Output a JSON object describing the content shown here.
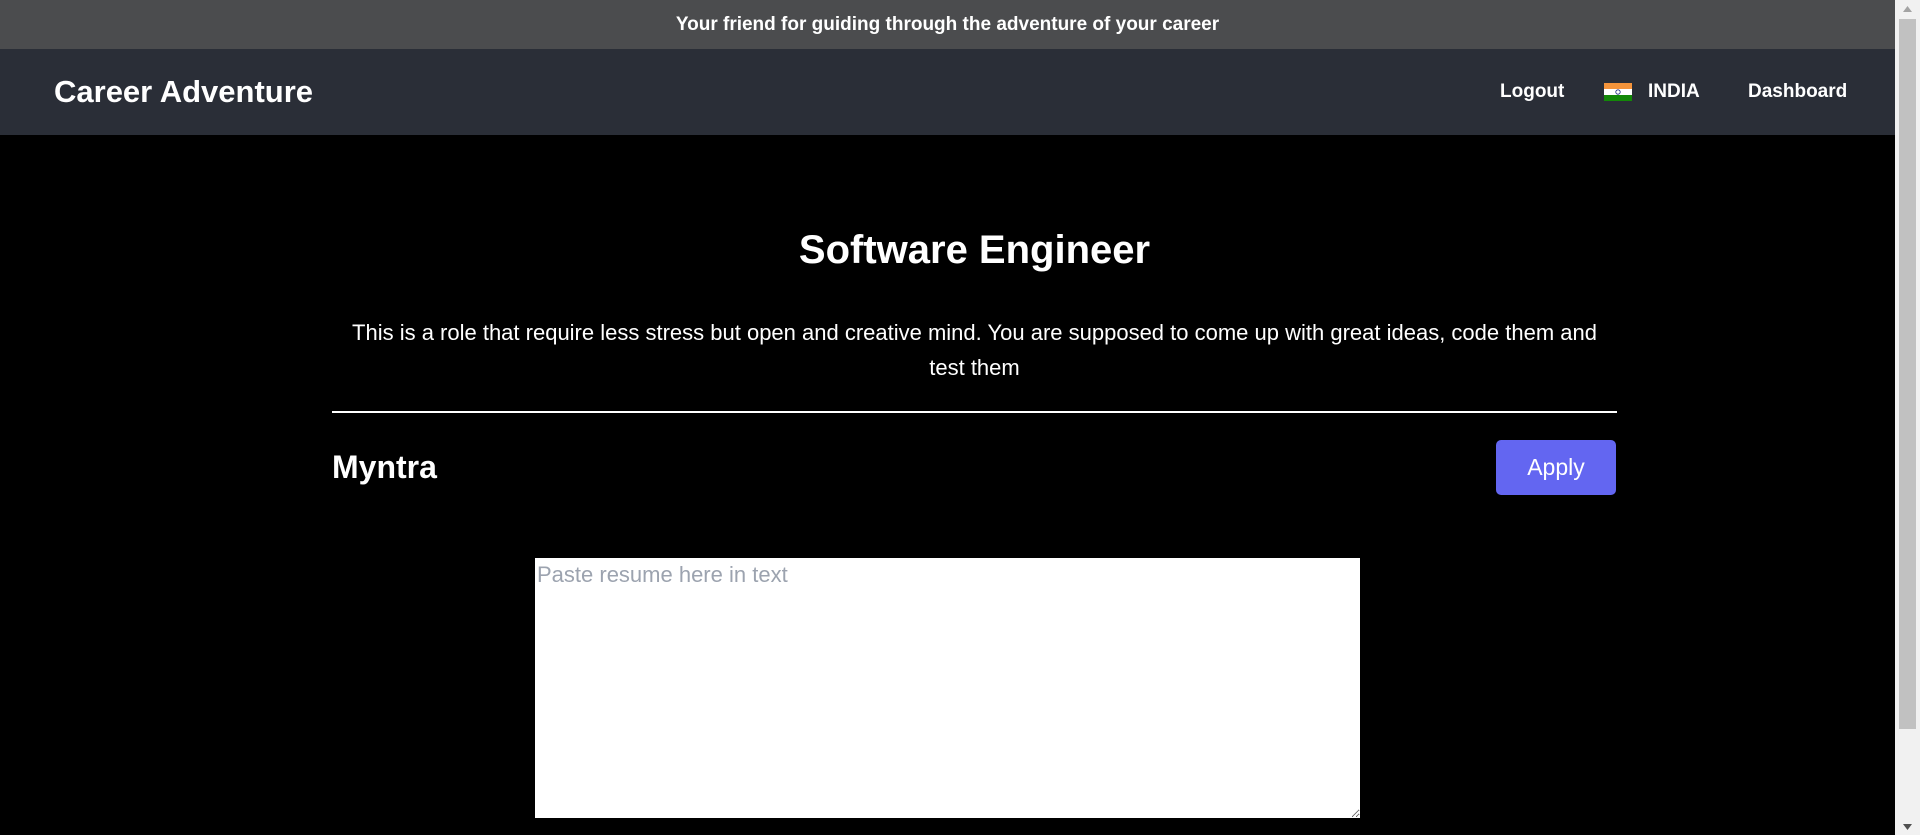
{
  "announcement": {
    "text": "Your friend for guiding through the adventure of your career"
  },
  "navbar": {
    "brand": "Career Adventure",
    "logout_label": "Logout",
    "country_label": "INDIA",
    "country_flag_icon": "india-flag-icon",
    "dashboard_label": "Dashboard"
  },
  "job": {
    "title": "Software Engineer",
    "description": "This is a role that require less stress but open and creative mind. You are supposed to come up with great ideas, code them and test them",
    "company": "Myntra",
    "apply_label": "Apply"
  },
  "resume": {
    "placeholder": "Paste resume here in text",
    "value": ""
  },
  "colors": {
    "announcement_bg": "#4b4c4e",
    "navbar_bg": "#2a2e37",
    "page_bg": "#000000",
    "accent": "#6366f1"
  }
}
